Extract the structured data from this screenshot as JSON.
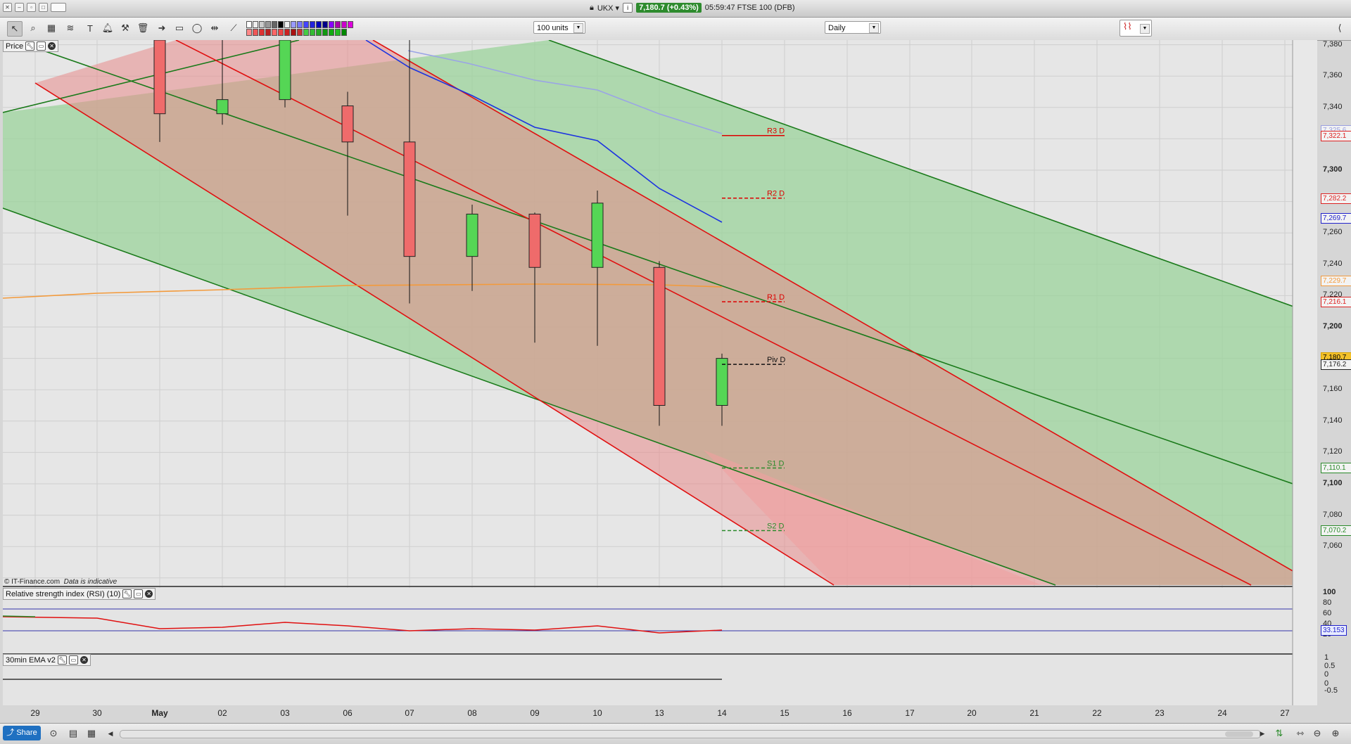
{
  "window": {
    "symbol": "UKX",
    "price_badge": "7,180.7 (+0.43%)",
    "time_title": "05:59:47 FTSE 100 (DFB)"
  },
  "toolbar": {
    "units_select": "100 units",
    "period_select": "Daily",
    "tools": [
      "pointer-icon",
      "zoom-icon",
      "chart-edit-icon",
      "fib-icon",
      "fib-fan-icon",
      "text-icon",
      "alert-bell-icon",
      "hammer-icon",
      "eraser-icon",
      "trash-icon",
      "arrow-right-icon",
      "rectangle-icon",
      "ellipse-icon",
      "horizontal-line-icon",
      "trendline-icon"
    ]
  },
  "panels": {
    "price_label": "Price",
    "rsi_label": "Relative strength index (RSI) (10)",
    "ema_label": "30min EMA v2"
  },
  "copyright": "© IT-Finance.com",
  "indicative": "Data is indicative",
  "price_axis": [
    "7,380",
    "7,360",
    "7,340",
    "7,300",
    "7,260",
    "7,240",
    "7,220",
    "7,200",
    "7,160",
    "7,140",
    "7,120",
    "7,100",
    "7,080",
    "7,060"
  ],
  "price_badges": [
    {
      "text": "7,325.6",
      "color": "#9aa0e0"
    },
    {
      "text": "7,322.1",
      "color": "#d22"
    },
    {
      "text": "7,282.2",
      "color": "#d22"
    },
    {
      "text": "7,269.7",
      "color": "#22c"
    },
    {
      "text": "7,229.7",
      "color": "#f39a3b"
    },
    {
      "text": "7,216.1",
      "color": "#d22"
    },
    {
      "text": "7,180.7",
      "color": "#d9a400"
    },
    {
      "text": "7,176.2",
      "color": "#222"
    },
    {
      "text": "7,110.1",
      "color": "#2a8a2a"
    },
    {
      "text": "7,070.2",
      "color": "#2a8a2a"
    }
  ],
  "pivots": [
    {
      "label": "R3 D",
      "value": 7322.1,
      "color": "#d00",
      "dashed": false
    },
    {
      "label": "R2 D",
      "value": 7282.2,
      "color": "#d00",
      "dashed": true
    },
    {
      "label": "R1 D",
      "value": 7216.1,
      "color": "#d00",
      "dashed": true
    },
    {
      "label": "Piv D",
      "value": 7176.2,
      "color": "#111",
      "dashed": true
    },
    {
      "label": "S1 D",
      "value": 7110.1,
      "color": "#2a8a2a",
      "dashed": true
    },
    {
      "label": "S2 D",
      "value": 7070.2,
      "color": "#2a8a2a",
      "dashed": true
    }
  ],
  "rsi_axis": [
    "100",
    "80",
    "60",
    "40",
    "20"
  ],
  "rsi_value": "33.153",
  "ema_axis": [
    "1",
    "0.5",
    "0",
    "0",
    "-0.5"
  ],
  "x_labels": [
    "29",
    "30",
    "May",
    "02",
    "03",
    "06",
    "07",
    "08",
    "09",
    "10",
    "13",
    "14",
    "15",
    "16",
    "17",
    "20",
    "21",
    "22",
    "23",
    "24",
    "27"
  ],
  "chart_data": {
    "type": "candlestick",
    "dates": [
      "30 Apr",
      "01 May",
      "02 May",
      "03 May",
      "06 May",
      "07 May",
      "08 May",
      "09 May",
      "10 May",
      "13 May",
      "14 May"
    ],
    "candles": [
      {
        "date": "01 May",
        "open": 7395,
        "high": 7400,
        "low": 7318,
        "close": 7336
      },
      {
        "date": "02 May",
        "open": 7336,
        "high": 7400,
        "low": 7329,
        "close": 7345
      },
      {
        "date": "03 May",
        "open": 7345,
        "high": 7400,
        "low": 7340,
        "close": 7400
      },
      {
        "date": "06 May",
        "open": 7341,
        "high": 7350,
        "low": 7271,
        "close": 7318
      },
      {
        "date": "07 May",
        "open": 7318,
        "high": 7400,
        "low": 7215,
        "close": 7245
      },
      {
        "date": "08 May",
        "open": 7245,
        "high": 7278,
        "low": 7223,
        "close": 7272
      },
      {
        "date": "09 May",
        "open": 7272,
        "high": 7273,
        "low": 7190,
        "close": 7238
      },
      {
        "date": "10 May",
        "open": 7238,
        "high": 7287,
        "low": 7188,
        "close": 7279
      },
      {
        "date": "13 May",
        "open": 7238,
        "high": 7242,
        "low": 7137,
        "close": 7150
      },
      {
        "date": "14 May",
        "open": 7150,
        "high": 7183,
        "low": 7137,
        "close": 7180
      }
    ],
    "ylim": [
      7020,
      7390
    ],
    "last_price": 7180.7
  }
}
